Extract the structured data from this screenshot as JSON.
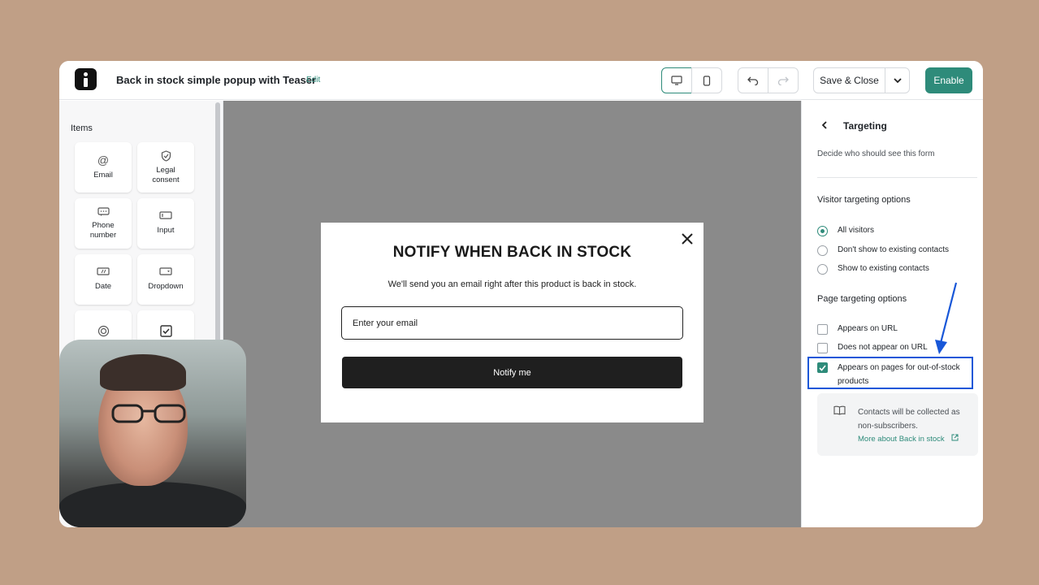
{
  "header": {
    "title": "Back in stock simple popup with Teaser",
    "edit_label": "Edit",
    "save_label": "Save & Close",
    "enable_label": "Enable"
  },
  "left_panel": {
    "section_label": "Items",
    "tiles": [
      {
        "label": "Email",
        "icon": "at-icon"
      },
      {
        "label": "Legal consent",
        "icon": "shield-check-icon"
      },
      {
        "label": "Phone number",
        "icon": "phone-field-icon"
      },
      {
        "label": "Input",
        "icon": "input-field-icon"
      },
      {
        "label": "Date",
        "icon": "date-field-icon"
      },
      {
        "label": "Dropdown",
        "icon": "dropdown-field-icon"
      }
    ]
  },
  "popup": {
    "title": "NOTIFY WHEN BACK IN STOCK",
    "subtitle": "We'll send you an email right after this product is back in stock.",
    "email_placeholder": "Enter your email",
    "button_label": "Notify me"
  },
  "right_panel": {
    "title": "Targeting",
    "subtitle": "Decide who should see this form",
    "visitor_heading": "Visitor targeting options",
    "visitor_options": [
      {
        "label": "All visitors",
        "selected": true
      },
      {
        "label": "Don't show to existing contacts",
        "selected": false
      },
      {
        "label": "Show to existing contacts",
        "selected": false
      }
    ],
    "page_heading": "Page targeting options",
    "page_options": [
      {
        "label": "Appears on URL",
        "checked": false
      },
      {
        "label": "Does not appear on URL",
        "checked": false
      },
      {
        "label": "Appears on pages for out-of-stock products",
        "checked": true
      }
    ],
    "info_text": "Contacts will be collected as non-subscribers.",
    "info_link": "More about Back in stock"
  },
  "colors": {
    "accent": "#2e8b7a",
    "annotation": "#1857d8",
    "background": "#c09f86"
  }
}
